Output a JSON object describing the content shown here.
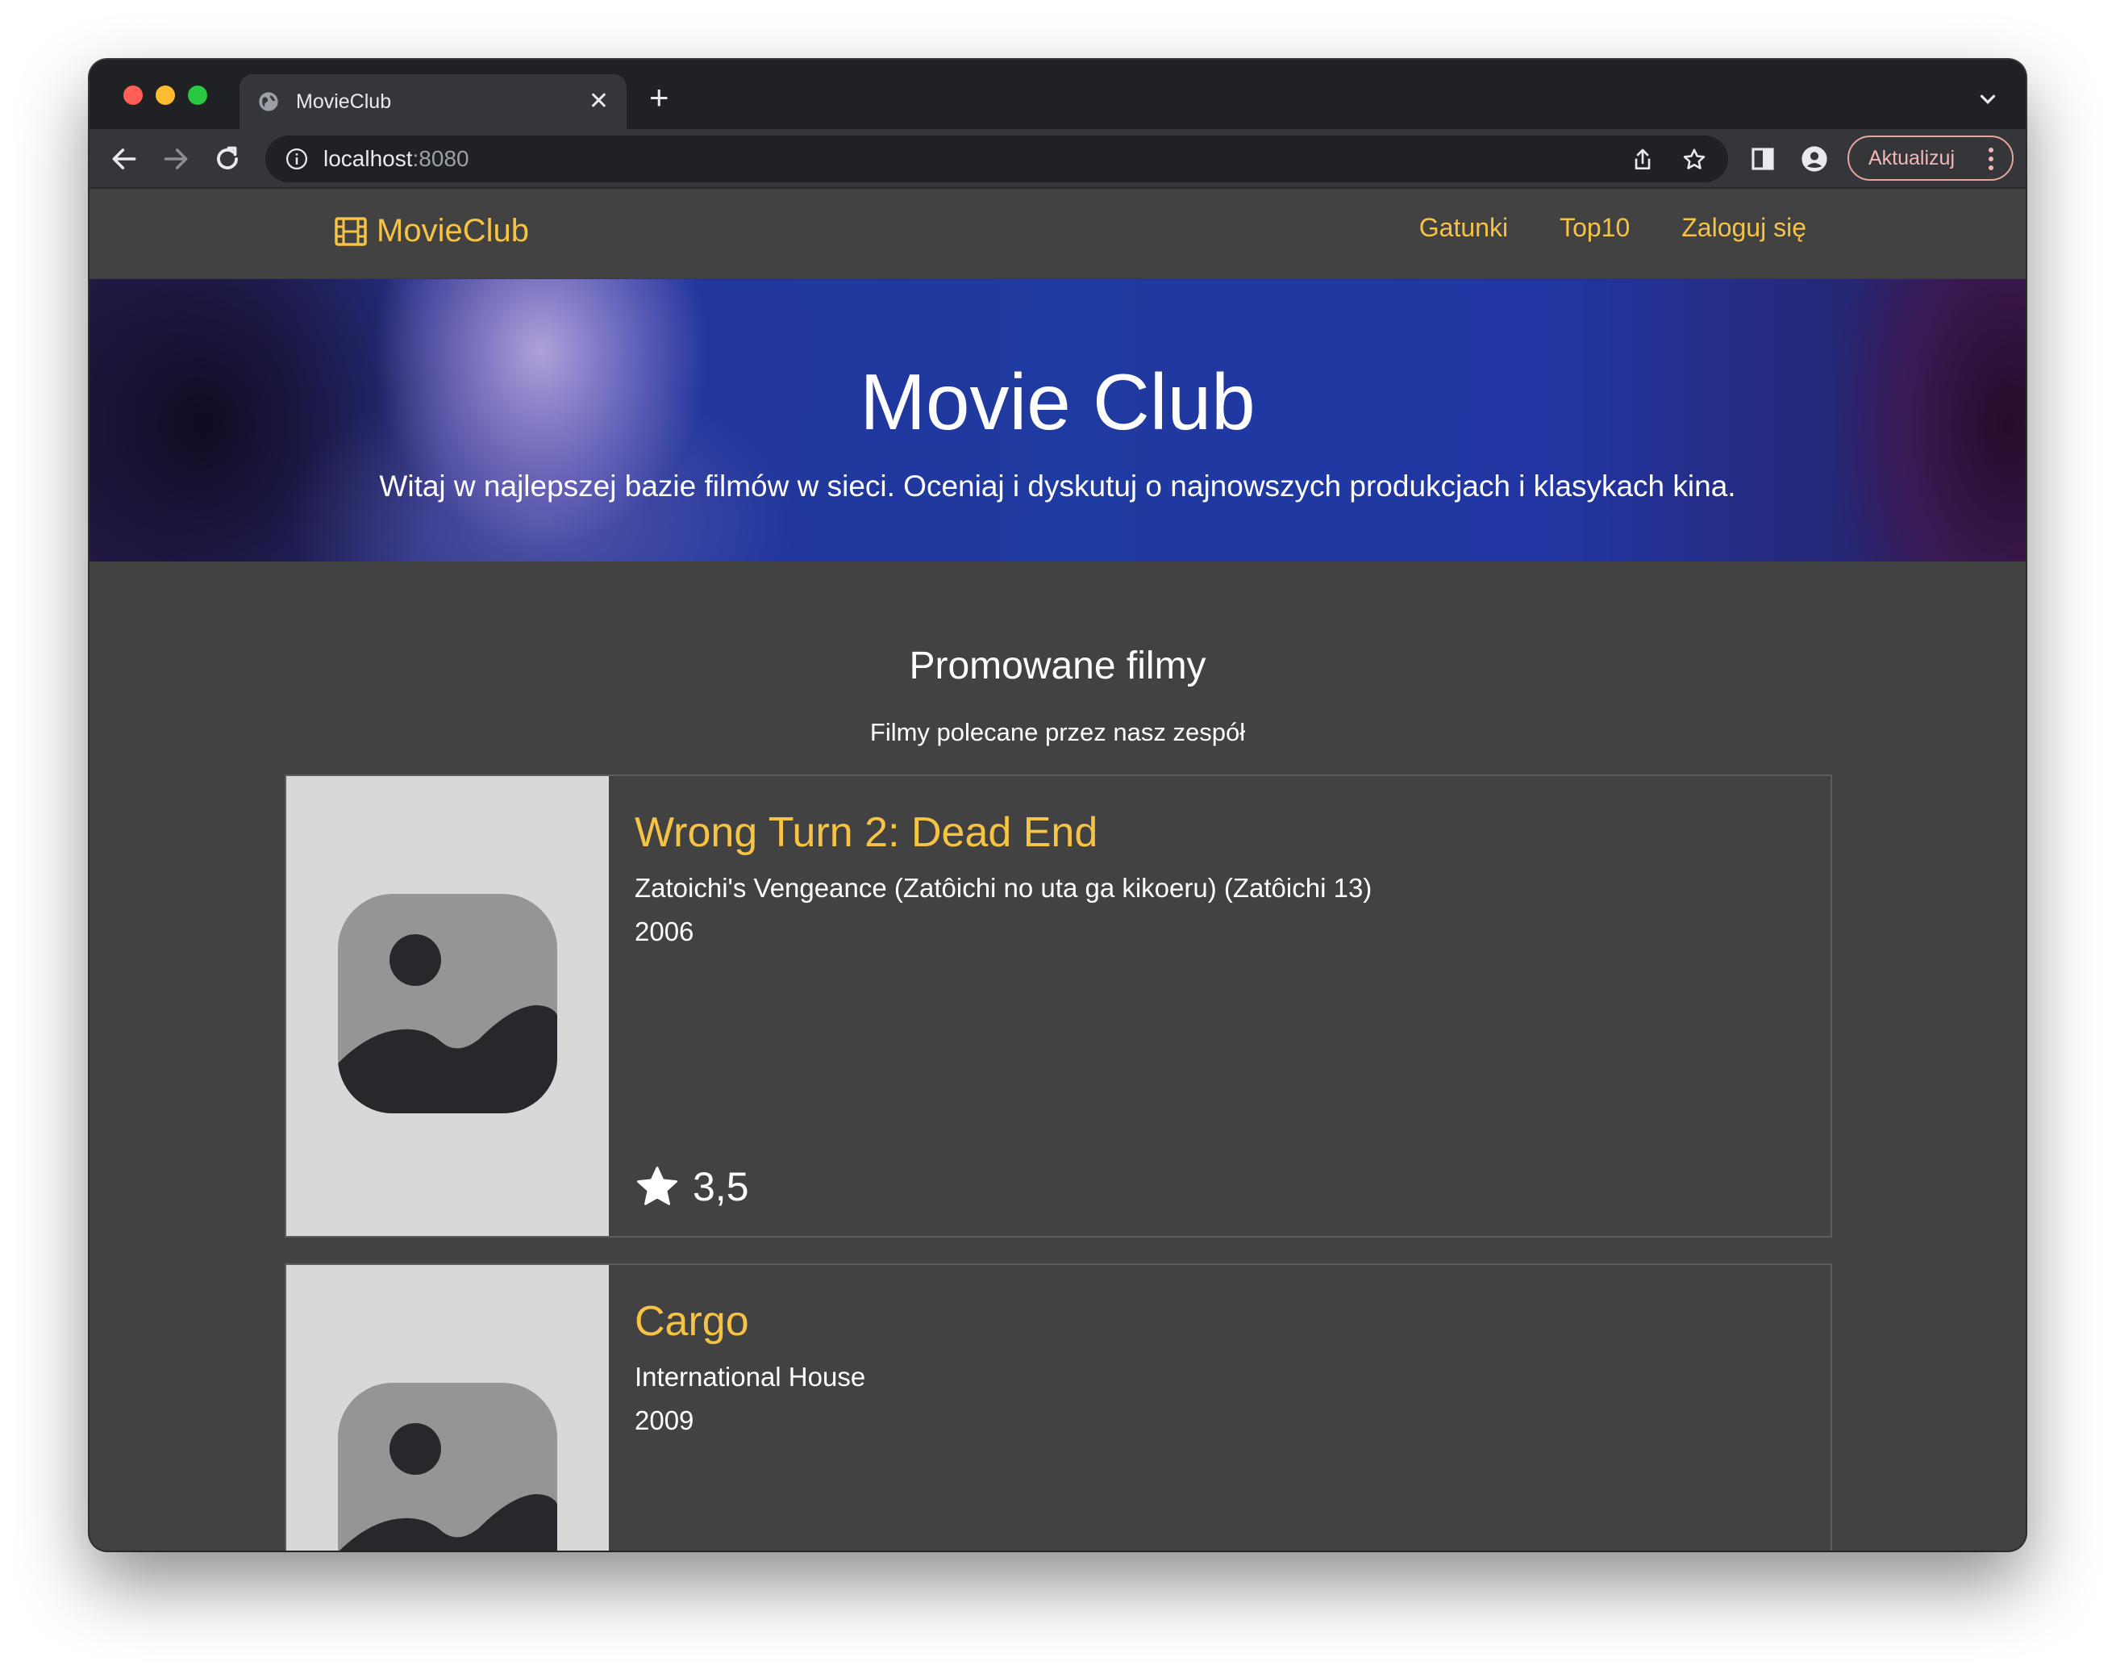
{
  "browser": {
    "tab_title": "MovieClub",
    "url_host": "localhost",
    "url_port": ":8080",
    "update_button": "Aktualizuj"
  },
  "navbar": {
    "brand": "MovieClub",
    "links": [
      "Gatunki",
      "Top10",
      "Zaloguj się"
    ]
  },
  "hero": {
    "title": "Movie Club",
    "subtitle": "Witaj w najlepszej bazie filmów w sieci. Oceniaj i dyskutuj o najnowszych produkcjach i klasykach kina."
  },
  "promoted": {
    "title": "Promowane filmy",
    "subtitle": "Filmy polecane przez nasz zespół",
    "movies": [
      {
        "title": "Wrong Turn 2: Dead End",
        "original_title": "Zatoichi's Vengeance (Zatôichi no uta ga kikoeru) (Zatôichi 13)",
        "year": "2006",
        "rating": "3,5"
      },
      {
        "title": "Cargo",
        "original_title": "International House",
        "year": "2009"
      }
    ]
  },
  "colors": {
    "accent": "#f6c344",
    "page_bg": "#424242",
    "placeholder_bg": "#d8d8d8"
  },
  "icons": [
    "globe-icon",
    "close-icon",
    "plus-icon",
    "chevron-down-icon",
    "back-icon",
    "forward-icon",
    "reload-icon",
    "info-icon",
    "share-icon",
    "star-bookmark-icon",
    "sidebar-icon",
    "profile-icon",
    "kebab-menu-icon",
    "film-icon",
    "image-placeholder-icon",
    "star-icon"
  ]
}
